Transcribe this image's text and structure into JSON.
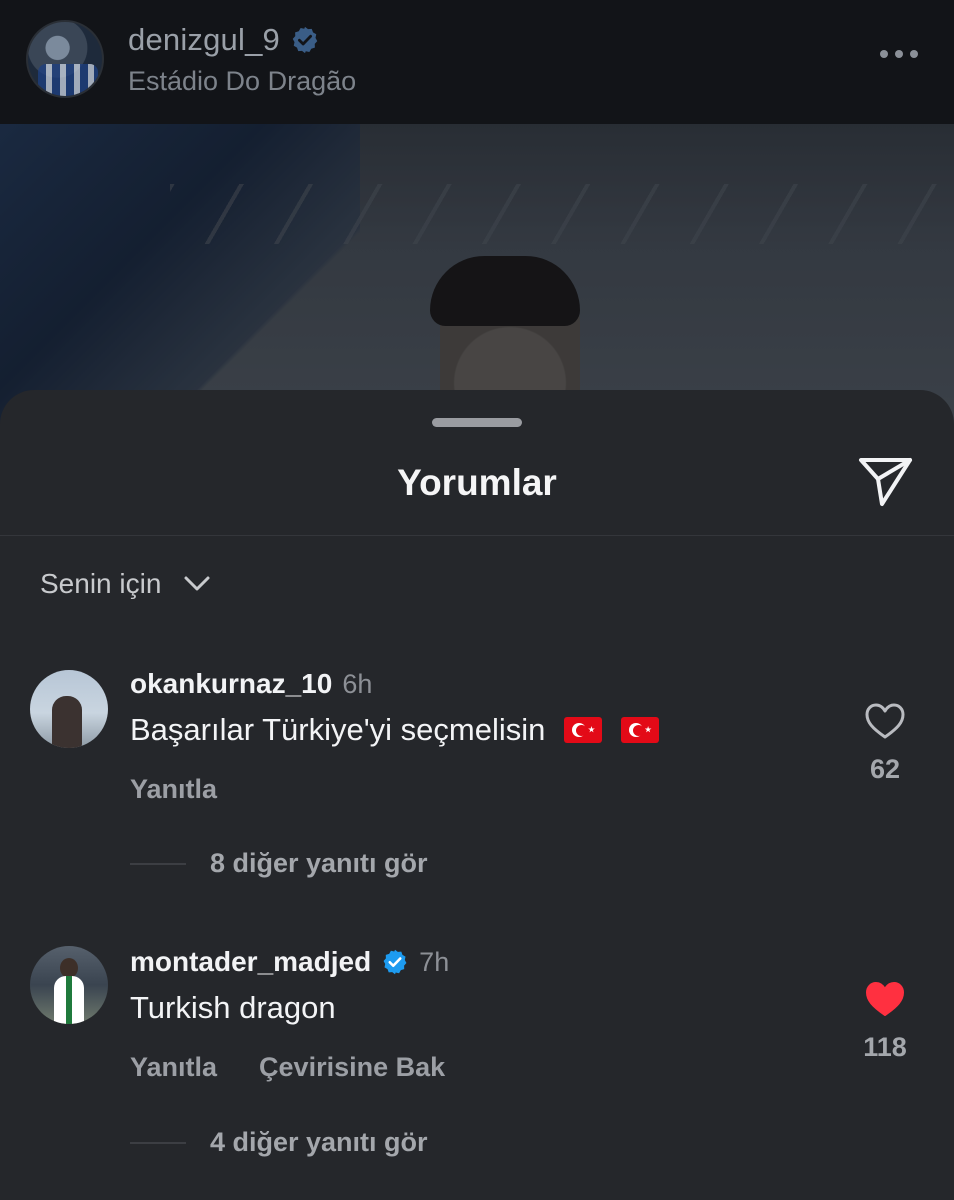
{
  "post": {
    "username": "denizgul_9",
    "location": "Estádio Do Dragão",
    "verified": true
  },
  "sheet": {
    "title": "Yorumlar",
    "filter_label": "Senin için"
  },
  "comments": [
    {
      "username": "okankurnaz_10",
      "time": "6h",
      "text": "Başarılar Türkiye'yi seçmelisin",
      "flags": 2,
      "reply_label": "Yanıtla",
      "like_count": "62",
      "liked": false,
      "view_replies": "8 diğer yanıtı gör"
    },
    {
      "username": "montader_madjed",
      "verified": true,
      "time": "7h",
      "text": "Turkish dragon",
      "reply_label": "Yanıtla",
      "translate_label": "Çevirisine Bak",
      "like_count": "118",
      "liked": true,
      "view_replies": "4 diğer yanıtı gör"
    }
  ],
  "colors": {
    "verified_blue": "#1d9bf0",
    "like_red": "#ff3040",
    "sheet_bg": "#25272b"
  }
}
